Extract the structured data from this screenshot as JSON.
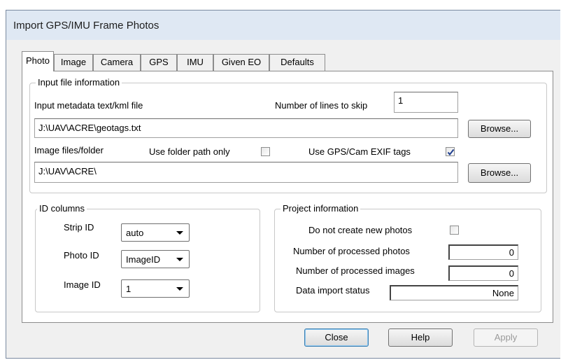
{
  "window": {
    "title": "Import GPS/IMU Frame Photos"
  },
  "tabs": [
    "Photo",
    "Image",
    "Camera",
    "GPS",
    "IMU",
    "Given EO",
    "Defaults"
  ],
  "input_group": {
    "legend": "Input file information",
    "metadata_label": "Input metadata text/kml file",
    "lines_to_skip_label": "Number of lines to skip",
    "lines_to_skip_value": "1",
    "metadata_path": "J:\\UAV\\ACRE\\geotags.txt",
    "browse_label": "Browse...",
    "image_folder_label": "Image files/folder",
    "use_folder_path_label": "Use folder path only",
    "use_folder_path_checked": false,
    "use_exif_label": "Use GPS/Cam EXIF tags",
    "use_exif_checked": true,
    "image_folder_path": "J:\\UAV\\ACRE\\"
  },
  "id_columns": {
    "legend": "ID columns",
    "strip_id_label": "Strip ID",
    "strip_id_value": "auto",
    "photo_id_label": "Photo ID",
    "photo_id_value": "ImageID",
    "image_id_label": "Image ID",
    "image_id_value": "1"
  },
  "project_info": {
    "legend": "Project information",
    "no_new_photos_label": "Do not create new photos",
    "no_new_photos_checked": false,
    "processed_photos_label": "Number of processed photos",
    "processed_photos_value": "0",
    "processed_images_label": "Number of processed images",
    "processed_images_value": "0",
    "import_status_label": "Data import status",
    "import_status_value": "None"
  },
  "buttons": {
    "close": "Close",
    "help": "Help",
    "apply": "Apply"
  },
  "colors": {
    "title_bar": "#dfe8f3",
    "dialog_bg": "#f0f0f0",
    "checkbox_check": "#1f3f8f"
  }
}
